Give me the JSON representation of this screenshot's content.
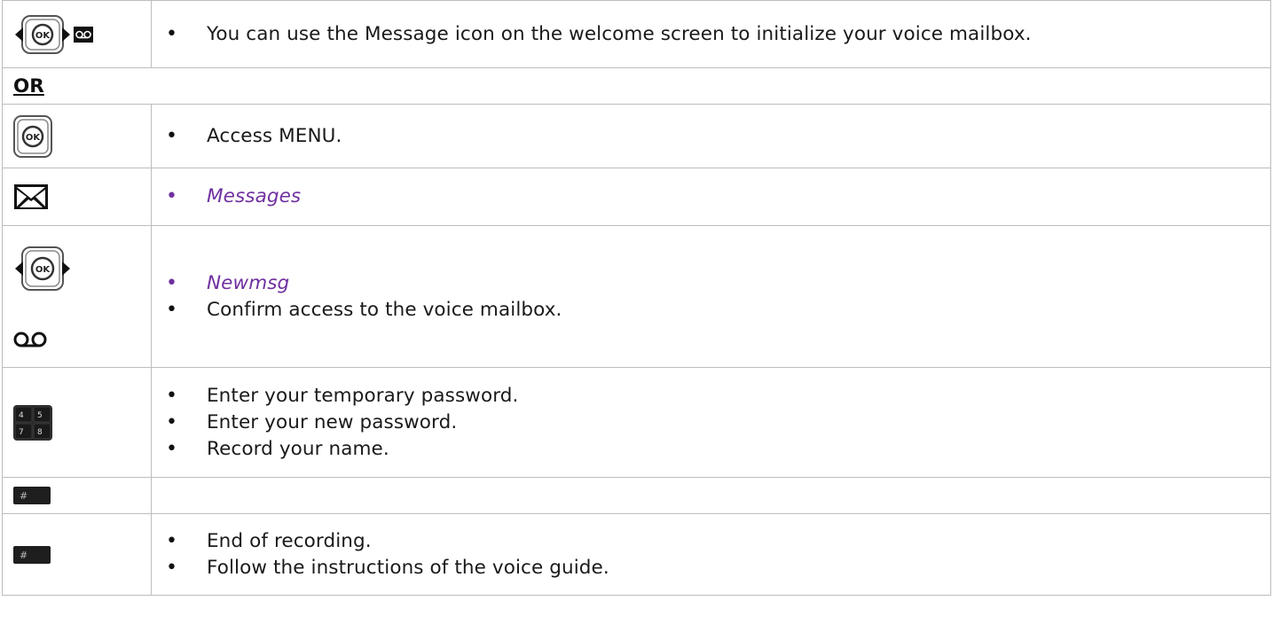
{
  "rows": [
    {
      "icons": [
        "ok-navigation-key-icon",
        "voicemail-key-icon"
      ],
      "items": [
        {
          "text": "You can use the Message icon on the welcome screen to initialize your voice mailbox.",
          "italic": false
        }
      ]
    },
    {
      "separator": "OR"
    },
    {
      "icons": [
        "ok-key-icon"
      ],
      "items": [
        {
          "text": "Access MENU.",
          "italic": false
        }
      ]
    },
    {
      "icons": [
        "envelope-icon"
      ],
      "items": [
        {
          "text": "Messages",
          "italic": true
        }
      ]
    },
    {
      "icons": [
        "ok-navigation-key-icon",
        "voicemail-icon"
      ],
      "items": [
        {
          "text": "Newmsg",
          "italic": true
        },
        {
          "text": "Confirm access to the voice mailbox.",
          "italic": false
        }
      ]
    },
    {
      "icons": [
        "keypad-icon"
      ],
      "items": [
        {
          "text": "Enter your temporary password.",
          "italic": false
        },
        {
          "text": "Enter your new password.",
          "italic": false
        },
        {
          "text": "Record your name.",
          "italic": false
        }
      ]
    },
    {
      "icons": [
        "hash-key-icon"
      ],
      "items": []
    },
    {
      "icons": [
        "hash-key-icon"
      ],
      "items": [
        {
          "text": "End of recording.",
          "italic": false
        },
        {
          "text": "Follow the instructions of the voice guide.",
          "italic": false
        }
      ]
    }
  ],
  "keypad": {
    "keys": [
      "4",
      "5",
      "7",
      "8"
    ]
  },
  "hash_key": {
    "label": "#"
  },
  "ok_key": {
    "label": "OK"
  },
  "colors": {
    "accent": "#7030a0",
    "border": "#bdbdbd",
    "key_dark": "#1c1c1c"
  }
}
